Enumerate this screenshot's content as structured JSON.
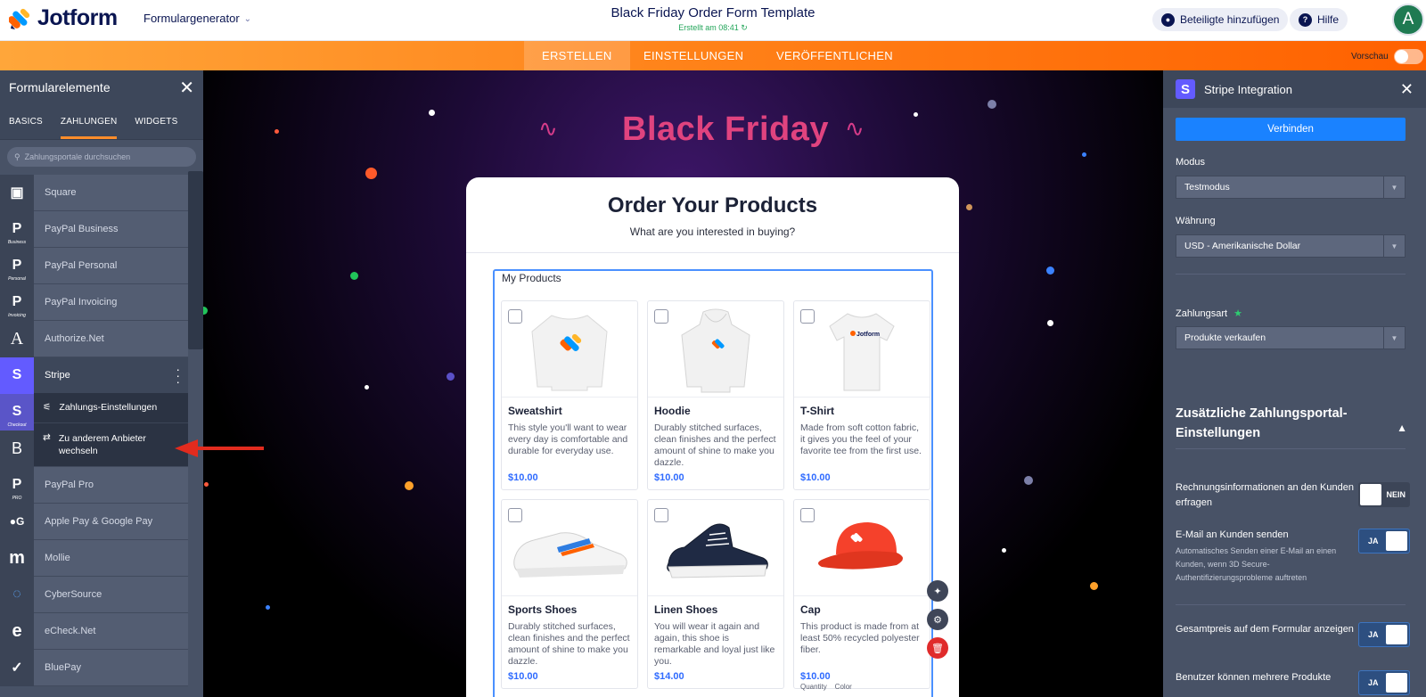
{
  "app": {
    "brand": "Jotform",
    "form_generator": "Formulargenerator",
    "title": "Black Friday Order Form Template",
    "subtitle": "Erstellt am 08:41",
    "add_participants": "Beteiligte hinzufügen",
    "help": "Hilfe",
    "avatar_letter": "A"
  },
  "main_tabs": [
    {
      "label": "ERSTELLEN"
    },
    {
      "label": "EINSTELLUNGEN"
    },
    {
      "label": "VERÖFFENTLICHEN"
    }
  ],
  "preview_label": "Vorschau",
  "left_panel": {
    "title": "Formularelemente",
    "tabs": [
      "BASICS",
      "ZAHLUNGEN",
      "WIDGETS"
    ],
    "search_placeholder": "Zahlungsportale durchsuchen",
    "items": [
      {
        "label": "Square",
        "icon": "square-icon"
      },
      {
        "label": "PayPal Business",
        "icon": "paypal-business-icon"
      },
      {
        "label": "PayPal Personal",
        "icon": "paypal-personal-icon"
      },
      {
        "label": "PayPal Invoicing",
        "icon": "paypal-invoicing-icon"
      },
      {
        "label": "Authorize.Net",
        "icon": "authorize-net-icon"
      },
      {
        "label": "Stripe",
        "icon": "stripe-icon"
      },
      {
        "label": "",
        "icon": "stripe-checkout-icon"
      },
      {
        "label": "",
        "icon": "braintree-icon"
      },
      {
        "label": "PayPal Pro",
        "icon": "paypal-pro-icon"
      },
      {
        "label": "Apple Pay & Google Pay",
        "icon": "apple-google-pay-icon"
      },
      {
        "label": "Mollie",
        "icon": "mollie-icon"
      },
      {
        "label": "CyberSource",
        "icon": "cybersource-icon"
      },
      {
        "label": "eCheck.Net",
        "icon": "echeck-icon"
      },
      {
        "label": "BluePay",
        "icon": "bluepay-icon"
      }
    ],
    "icon_small_labels": {
      "business": "Business",
      "personal": "Personal",
      "invoicing": "Invoicing",
      "checkout": "Checkout",
      "pro": "PRO"
    },
    "submenu": {
      "payment_settings": "Zahlungs-Einstellungen",
      "switch_provider": "Zu anderem Anbieter wechseln"
    }
  },
  "form": {
    "hero": "Black Friday",
    "heading": "Order Your Products",
    "subheading": "What are you interested in buying?",
    "products_label": "My Products",
    "products": [
      {
        "name": "Sweatshirt",
        "desc": "This style you'll want to wear every day is comfortable and durable for everyday use.",
        "price": "$10.00"
      },
      {
        "name": "Hoodie",
        "desc": "Durably stitched surfaces, clean finishes and the perfect amount of shine to make you dazzle.",
        "price": "$10.00"
      },
      {
        "name": "T-Shirt",
        "desc": "Made from soft cotton fabric, it gives you the feel of your favorite tee from the first use.",
        "price": "$10.00"
      },
      {
        "name": "Sports Shoes",
        "desc": "Durably stitched surfaces, clean finishes and the perfect amount of shine to make you dazzle.",
        "price": "$10.00"
      },
      {
        "name": "Linen Shoes",
        "desc": "You will wear it again and again, this shoe is remarkable and loyal just like you.",
        "price": "$14.00"
      },
      {
        "name": "Cap",
        "desc": "This product is made from at least 50% recycled polyester fiber.",
        "price": "$10.00"
      }
    ],
    "cap_options": "Quantity    Color",
    "tshirt_logo": "Jotform"
  },
  "right_panel": {
    "title": "Stripe Integration",
    "connect": "Verbinden",
    "mode_label": "Modus",
    "mode_value": "Testmodus",
    "currency_label": "Währung",
    "currency_value": "USD - Amerikanische Dollar",
    "payment_type_label": "Zahlungsart",
    "payment_type_value": "Produkte verkaufen",
    "additional_section": "Zusätzliche Zahlungsportal-Einstellungen",
    "options": [
      {
        "label": "Rechnungsinformationen an den Kunden erfragen",
        "desc": "",
        "value": "NEIN"
      },
      {
        "label": "E-Mail an Kunden senden",
        "desc": "Automatisches Senden einer E-Mail an einen Kunden, wenn 3D Secure-Authentifizierungsprobleme auftreten",
        "value": "JA"
      },
      {
        "label": "Gesamtpreis auf dem Formular anzeigen",
        "desc": "",
        "value": "JA"
      },
      {
        "label": "Benutzer können mehrere Produkte",
        "desc": "",
        "value": "JA"
      }
    ]
  },
  "colors": {
    "brand_navy": "#0a1551",
    "orange": "#ff8118",
    "stripe": "#635bff",
    "connect_blue": "#1a82ff",
    "price_blue": "#2f6bff",
    "hero_pink": "#e0437f",
    "arrow_red": "#e22b1e"
  }
}
